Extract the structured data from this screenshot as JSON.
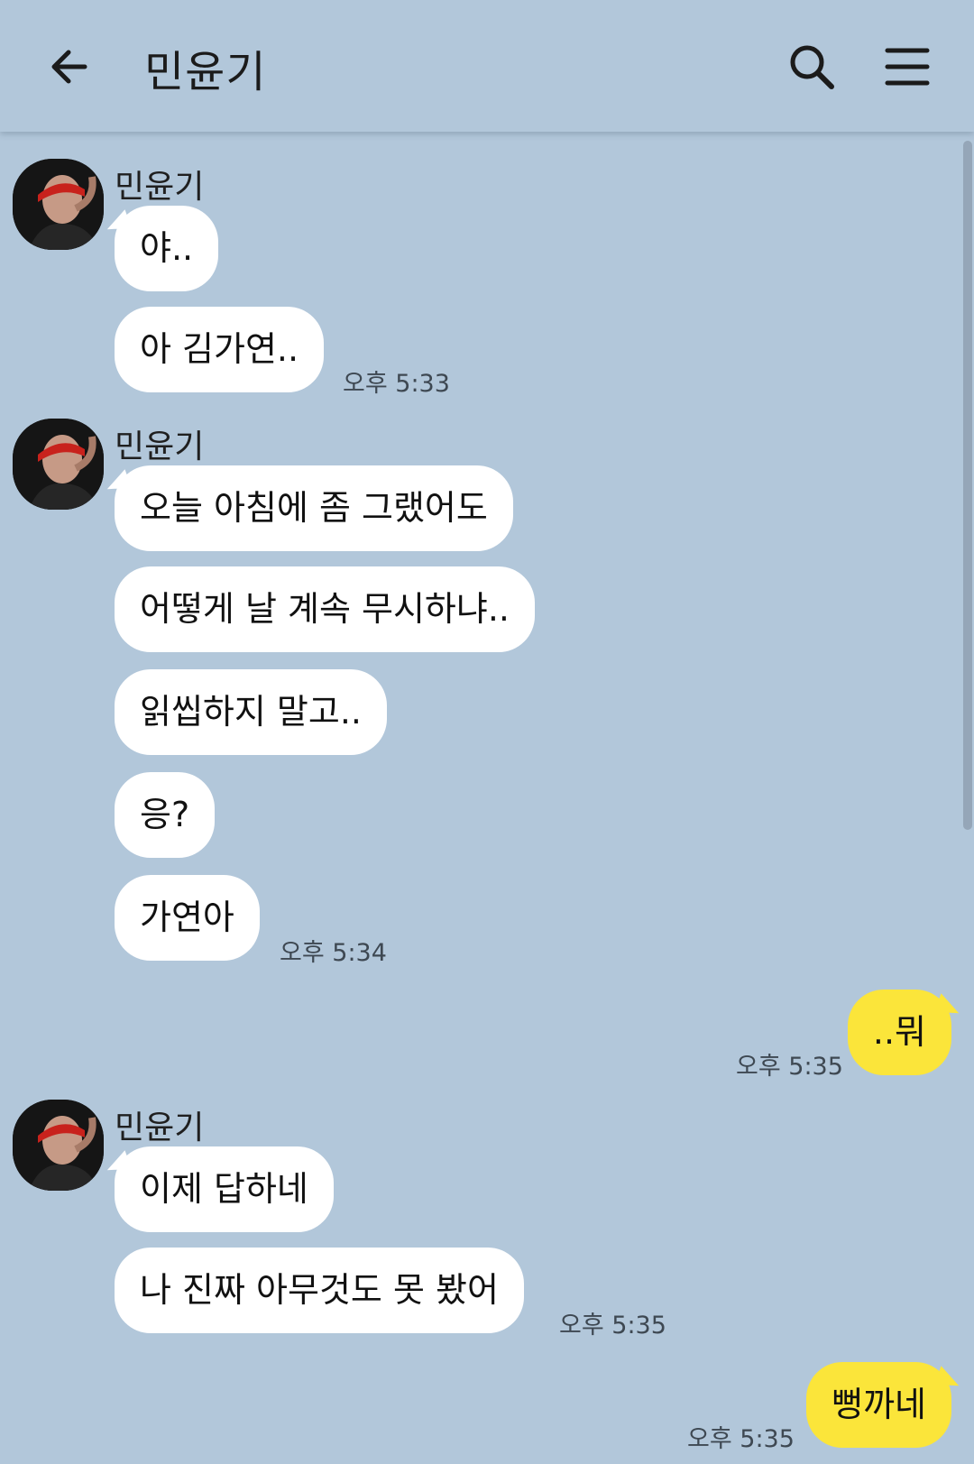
{
  "header": {
    "title": "민윤기"
  },
  "icons": {
    "back": "arrow-left-icon",
    "search": "search-icon",
    "menu": "hamburger-menu-icon"
  },
  "colors": {
    "background": "#b2c7da",
    "incoming_bubble": "#ffffff",
    "outgoing_bubble": "#fbe53a"
  },
  "groups": [
    {
      "sender": "민윤기",
      "messages": [
        "야..",
        "아 김가연.."
      ],
      "time": "오후 5:33"
    },
    {
      "sender": "민윤기",
      "messages": [
        "오늘 아침에 좀 그랬어도",
        "어떻게 날 계속 무시하냐..",
        "읽씹하지 말고..",
        "응?",
        "가연아"
      ],
      "time": "오후 5:34"
    },
    {
      "sender": "me",
      "messages": [
        "..뭐"
      ],
      "time": "오후 5:35"
    },
    {
      "sender": "민윤기",
      "messages": [
        "이제 답하네",
        "나 진짜 아무것도 못 봤어"
      ],
      "time": "오후 5:35"
    },
    {
      "sender": "me",
      "messages": [
        "뻥까네"
      ],
      "time": "오후 5:35"
    }
  ]
}
